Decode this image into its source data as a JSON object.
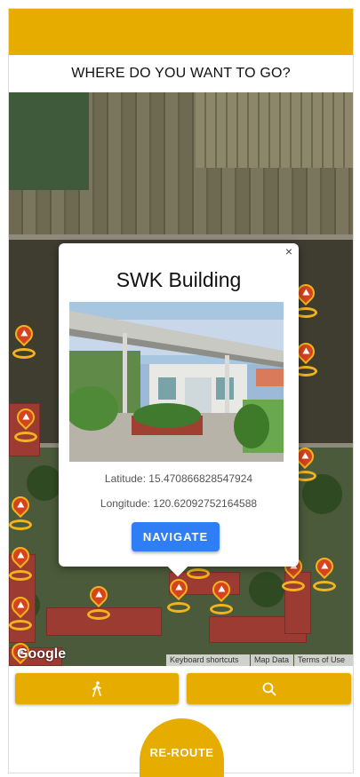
{
  "header": {
    "title": "WHERE DO YOU WANT TO GO?"
  },
  "map": {
    "attribution_logo": "Google",
    "links": [
      "Keyboard shortcuts",
      "Map Data",
      "Terms of Use"
    ]
  },
  "popup": {
    "close_glyph": "×",
    "title": "SWK Building",
    "latitude_text": "Latitude: 15.470866828547924",
    "longitude_text": "Longitude: 120.62092752164588",
    "navigate_label": "NAVIGATE"
  },
  "actions": {
    "walk_icon": "walking-person-icon",
    "search_icon": "search-icon",
    "reroute_label": "RE-ROUTE"
  },
  "colors": {
    "accent": "#e6ad00",
    "primary_button": "#2f7ef5",
    "marker": "#d6441f"
  }
}
